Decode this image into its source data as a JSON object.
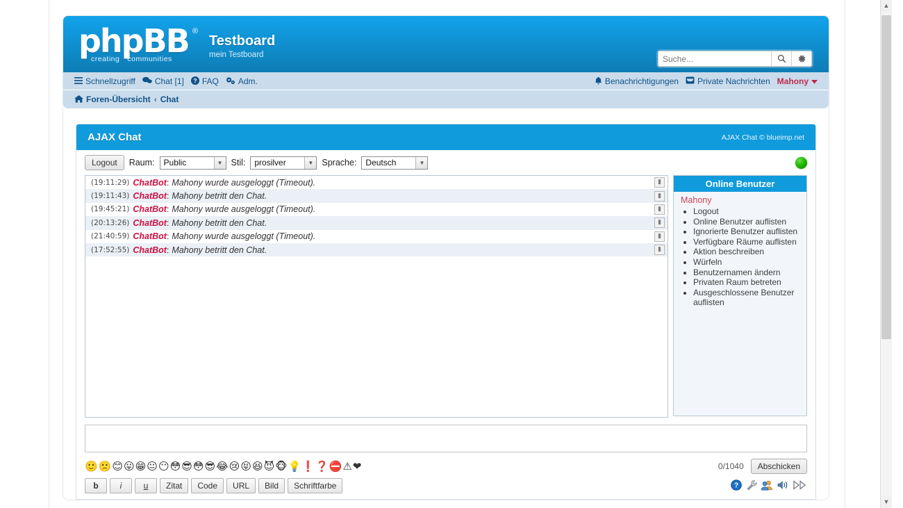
{
  "browser": {
    "scrollbar_up": "▲",
    "scrollbar_down": "▼"
  },
  "header": {
    "logo_text": "phpBB",
    "logo_registered": "®",
    "logo_tagline_left": "creating",
    "logo_tagline_right": "communities",
    "site_title": "Testboard",
    "site_description": "mein Testboard",
    "search_placeholder": "Suche...",
    "search_icon": "search-icon",
    "search_options_icon": "gear-icon"
  },
  "navbar": {
    "left": [
      {
        "label": "Schnellzugriff",
        "icon": "hamburger-icon"
      },
      {
        "label": "Chat [1]",
        "icon": "chat-bubbles-icon"
      },
      {
        "label": "FAQ",
        "icon": "question-circle-icon"
      },
      {
        "label": "Adm.",
        "icon": "gears-icon"
      }
    ],
    "right": [
      {
        "label": "Benachrichtigungen",
        "icon": "bell-icon"
      },
      {
        "label": "Private Nachrichten",
        "icon": "envelope-icon"
      },
      {
        "label": "Mahony",
        "icon": "chevron-down-icon"
      }
    ]
  },
  "breadcrumb": {
    "home_icon": "home-icon",
    "items": [
      "Foren-Übersicht",
      "Chat"
    ],
    "separator": "‹"
  },
  "chat": {
    "title": "AJAX Chat",
    "credit": "AJAX Chat © blueimp.net",
    "toolbar": {
      "logout_label": "Logout",
      "room_label": "Raum:",
      "room_value": "Public",
      "style_label": "Stil:",
      "style_value": "prosilver",
      "language_label": "Sprache:",
      "language_value": "Deutsch",
      "status_icon": "green-status-led"
    },
    "messages": [
      {
        "time": "(19:11:29)",
        "user": "ChatBot",
        "text": "Mahony wurde ausgeloggt (Timeout)."
      },
      {
        "time": "(19:11:43)",
        "user": "ChatBot",
        "text": "Mahony betritt den Chat."
      },
      {
        "time": "(19:45:21)",
        "user": "ChatBot",
        "text": "Mahony wurde ausgeloggt (Timeout)."
      },
      {
        "time": "(20:13:26)",
        "user": "ChatBot",
        "text": "Mahony betritt den Chat."
      },
      {
        "time": "(21:40:59)",
        "user": "ChatBot",
        "text": "Mahony wurde ausgeloggt (Timeout)."
      },
      {
        "time": "(17:52:55)",
        "user": "ChatBot",
        "text": "Mahony betritt den Chat."
      }
    ],
    "message_delete_icon": "broken-image-icon",
    "online": {
      "title": "Online Benutzer",
      "user": "Mahony",
      "actions": [
        "Logout",
        "Online Benutzer auflisten",
        "Ignorierte Benutzer auflisten",
        "Verfügbare Räume auflisten",
        "Aktion beschreiben",
        "Würfeln",
        "Benutzernamen ändern",
        "Privaten Raum betreten",
        "Ausgeschlossene Benutzer auflisten"
      ]
    },
    "input_value": "",
    "emoticons": [
      "🙂",
      "🙁",
      "😊",
      "😛",
      "😁",
      "😐",
      "😶",
      "😳",
      "😎",
      "😳",
      "😎",
      "😂",
      "😢",
      "😝",
      "😆",
      "😈",
      "🐵",
      "💡",
      "❗",
      "❓",
      "⛔",
      "⚠",
      "❤"
    ],
    "counter": "0/1040",
    "submit_label": "Abschicken",
    "bbcode_buttons": [
      {
        "label": "b",
        "style": "bold"
      },
      {
        "label": "i",
        "style": "italic"
      },
      {
        "label": "u",
        "style": "underline"
      },
      {
        "label": "Zitat",
        "style": "normal"
      },
      {
        "label": "Code",
        "style": "normal"
      },
      {
        "label": "URL",
        "style": "normal"
      },
      {
        "label": "Bild",
        "style": "normal"
      },
      {
        "label": "Schriftfarbe",
        "style": "normal"
      }
    ],
    "bottom_icons": [
      {
        "name": "help-icon",
        "glyph": "❓"
      },
      {
        "name": "tools-icon",
        "glyph": "🛠"
      },
      {
        "name": "users-icon",
        "glyph": "👥"
      },
      {
        "name": "sound-icon",
        "glyph": "🔊"
      },
      {
        "name": "fast-forward-icon",
        "glyph": "▷▷"
      }
    ]
  },
  "colors": {
    "brand_blue": "#0f9bdc",
    "header_blue_dark": "#0d7cb5",
    "nav_blue": "#cadceb",
    "link_blue": "#105289",
    "user_red": "#bc2a4d",
    "bot_red": "#cc1144",
    "row_alt": "#eaf0f6",
    "status_green": "#21b800"
  }
}
